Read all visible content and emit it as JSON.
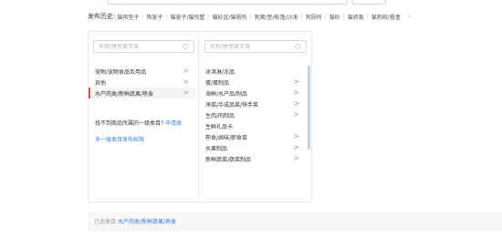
{
  "history": {
    "label": "发布历史:",
    "items": [
      "猫狗垫子",
      "狗笼子",
      "猫笼子/猫别墅",
      "猫砂盆/猫厕所",
      "狗窝/垫/帐篷/沙发",
      "狗厕所",
      "猫砂",
      "猫抓板",
      "猫狗碗/餐盒"
    ],
    "more_icon": "chevron-right"
  },
  "col1": {
    "search_placeholder": "名称/拼音首字母",
    "items": [
      {
        "label": "宠物/宠物食品及用品",
        "chevron": ">"
      },
      {
        "label": "其他",
        "chevron": ">"
      },
      {
        "label": "水产肉类/新鲜蔬果/熟食",
        "chevron": ">"
      }
    ],
    "note_text": "找不到商品所属的一级类目?",
    "note_link": "申请类",
    "permission_link": "多一级类目发布权限"
  },
  "col2": {
    "search_placeholder": "名称/拼音首字母",
    "items": [
      {
        "label": "冰淇淋/冻品",
        "chevron": ""
      },
      {
        "label": "蛋/蛋制品",
        "chevron": ">"
      },
      {
        "label": "海鲜/水产品/制品",
        "chevron": ">"
      },
      {
        "label": "净菜/半成品菜/快手菜",
        "chevron": ">"
      },
      {
        "label": "生肉/肉制品",
        "chevron": ">"
      },
      {
        "label": "生鲜礼品卡",
        "chevron": ""
      },
      {
        "label": "熟食/卤味/即食菜",
        "chevron": ">"
      },
      {
        "label": "水果制品",
        "chevron": ">"
      },
      {
        "label": "新鲜蔬菜/蔬菜制品",
        "chevron": ">"
      }
    ]
  },
  "selected": {
    "label": "已选类目:",
    "value": "水产肉类/新鲜蔬果/熟食"
  },
  "colors": {
    "link": "#3a7bd5",
    "active_marker": "#d9534f",
    "scrollbar": "#c7d0db"
  }
}
